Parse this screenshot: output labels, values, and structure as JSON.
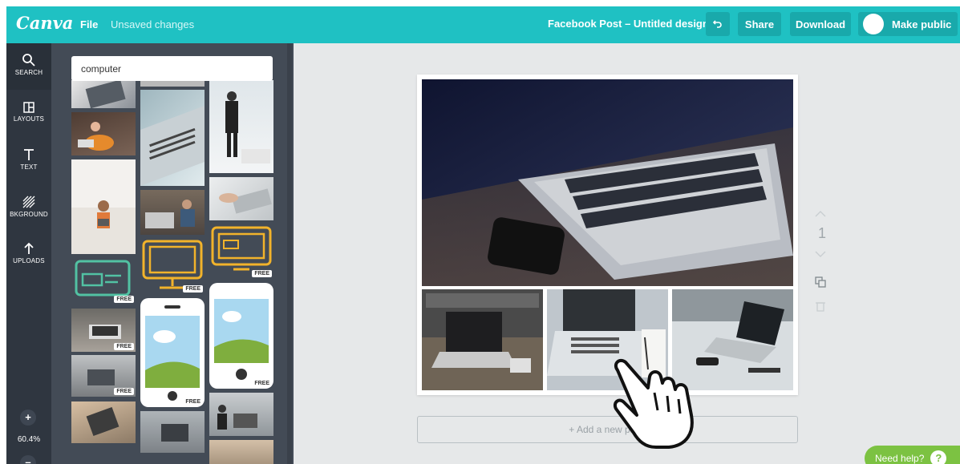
{
  "topbar": {
    "logo": "Canva",
    "file_label": "File",
    "status_text": "Unsaved changes",
    "doc_title": "Facebook Post – Untitled design",
    "share_label": "Share",
    "download_label": "Download",
    "public_label": "Make public"
  },
  "rail": {
    "items": [
      {
        "label": "SEARCH",
        "icon": "search-icon"
      },
      {
        "label": "LAYOUTS",
        "icon": "layouts-icon"
      },
      {
        "label": "TEXT",
        "icon": "text-icon"
      },
      {
        "label": "BKGROUND",
        "icon": "background-icon"
      },
      {
        "label": "UPLOADS",
        "icon": "upload-icon"
      }
    ],
    "zoom_value": "60.4%"
  },
  "panel": {
    "search_value": "computer",
    "free_label": "FREE"
  },
  "canvas": {
    "page_number": "1",
    "add_page_label": "+ Add a new page"
  },
  "help": {
    "label": "Need help?",
    "icon_text": "?"
  },
  "colors": {
    "brand": "#1fc1c3",
    "rail": "#293039",
    "panel": "#434b56",
    "canvas_bg": "#e6e8e9",
    "help_green": "#7cc242",
    "illustration_green": "#52c2a3",
    "illustration_yellow": "#f2b32b"
  }
}
